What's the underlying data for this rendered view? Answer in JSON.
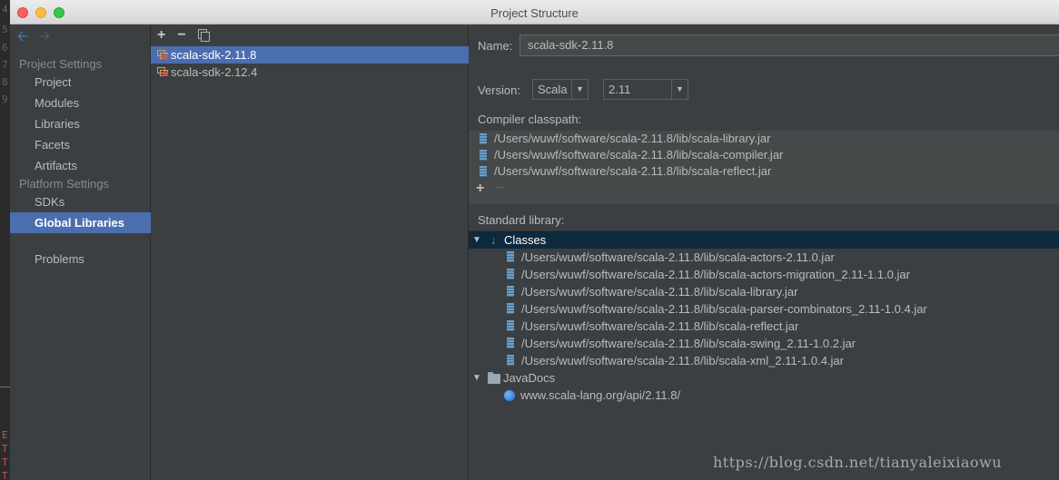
{
  "window": {
    "title": "Project Structure"
  },
  "editor_strip": {
    "line_numbers": [
      "4",
      "5",
      "6",
      "7",
      "8",
      "9"
    ],
    "error_letters": [
      "E",
      "T",
      "T",
      "T"
    ]
  },
  "nav": {
    "project_settings_header": "Project Settings",
    "project_settings_items": [
      "Project",
      "Modules",
      "Libraries",
      "Facets",
      "Artifacts"
    ],
    "platform_settings_header": "Platform Settings",
    "platform_settings_items": [
      "SDKs",
      "Global Libraries"
    ],
    "selected": "Global Libraries",
    "problems": "Problems"
  },
  "sdk_list": {
    "items": [
      "scala-sdk-2.11.8",
      "scala-sdk-2.12.4"
    ],
    "selected_index": 0,
    "toolbar": {
      "add": "+",
      "remove": "−"
    }
  },
  "detail": {
    "name_label": "Name:",
    "name_value": "scala-sdk-2.11.8",
    "version_label": "Version:",
    "version_type": "Scala",
    "version_number": "2.11",
    "compiler_classpath_label": "Compiler classpath:",
    "compiler_classpath": [
      "/Users/wuwf/software/scala-2.11.8/lib/scala-library.jar",
      "/Users/wuwf/software/scala-2.11.8/lib/scala-compiler.jar",
      "/Users/wuwf/software/scala-2.11.8/lib/scala-reflect.jar"
    ],
    "classpath_add": "+",
    "classpath_remove": "−",
    "standard_library_label": "Standard library:",
    "classes_label": "Classes",
    "classes": [
      "/Users/wuwf/software/scala-2.11.8/lib/scala-actors-2.11.0.jar",
      "/Users/wuwf/software/scala-2.11.8/lib/scala-actors-migration_2.11-1.1.0.jar",
      "/Users/wuwf/software/scala-2.11.8/lib/scala-library.jar",
      "/Users/wuwf/software/scala-2.11.8/lib/scala-parser-combinators_2.11-1.0.4.jar",
      "/Users/wuwf/software/scala-2.11.8/lib/scala-reflect.jar",
      "/Users/wuwf/software/scala-2.11.8/lib/scala-swing_2.11-1.0.2.jar",
      "/Users/wuwf/software/scala-2.11.8/lib/scala-xml_2.11-1.0.4.jar"
    ],
    "javadocs_label": "JavaDocs",
    "javadocs": [
      "www.scala-lang.org/api/2.11.8/"
    ]
  },
  "watermark": "https://blog.csdn.net/tianyaleixiaowu",
  "colors": {
    "selection": "#4b6eaf",
    "tree_selection": "#0d293e",
    "panel": "#3c3f41"
  }
}
